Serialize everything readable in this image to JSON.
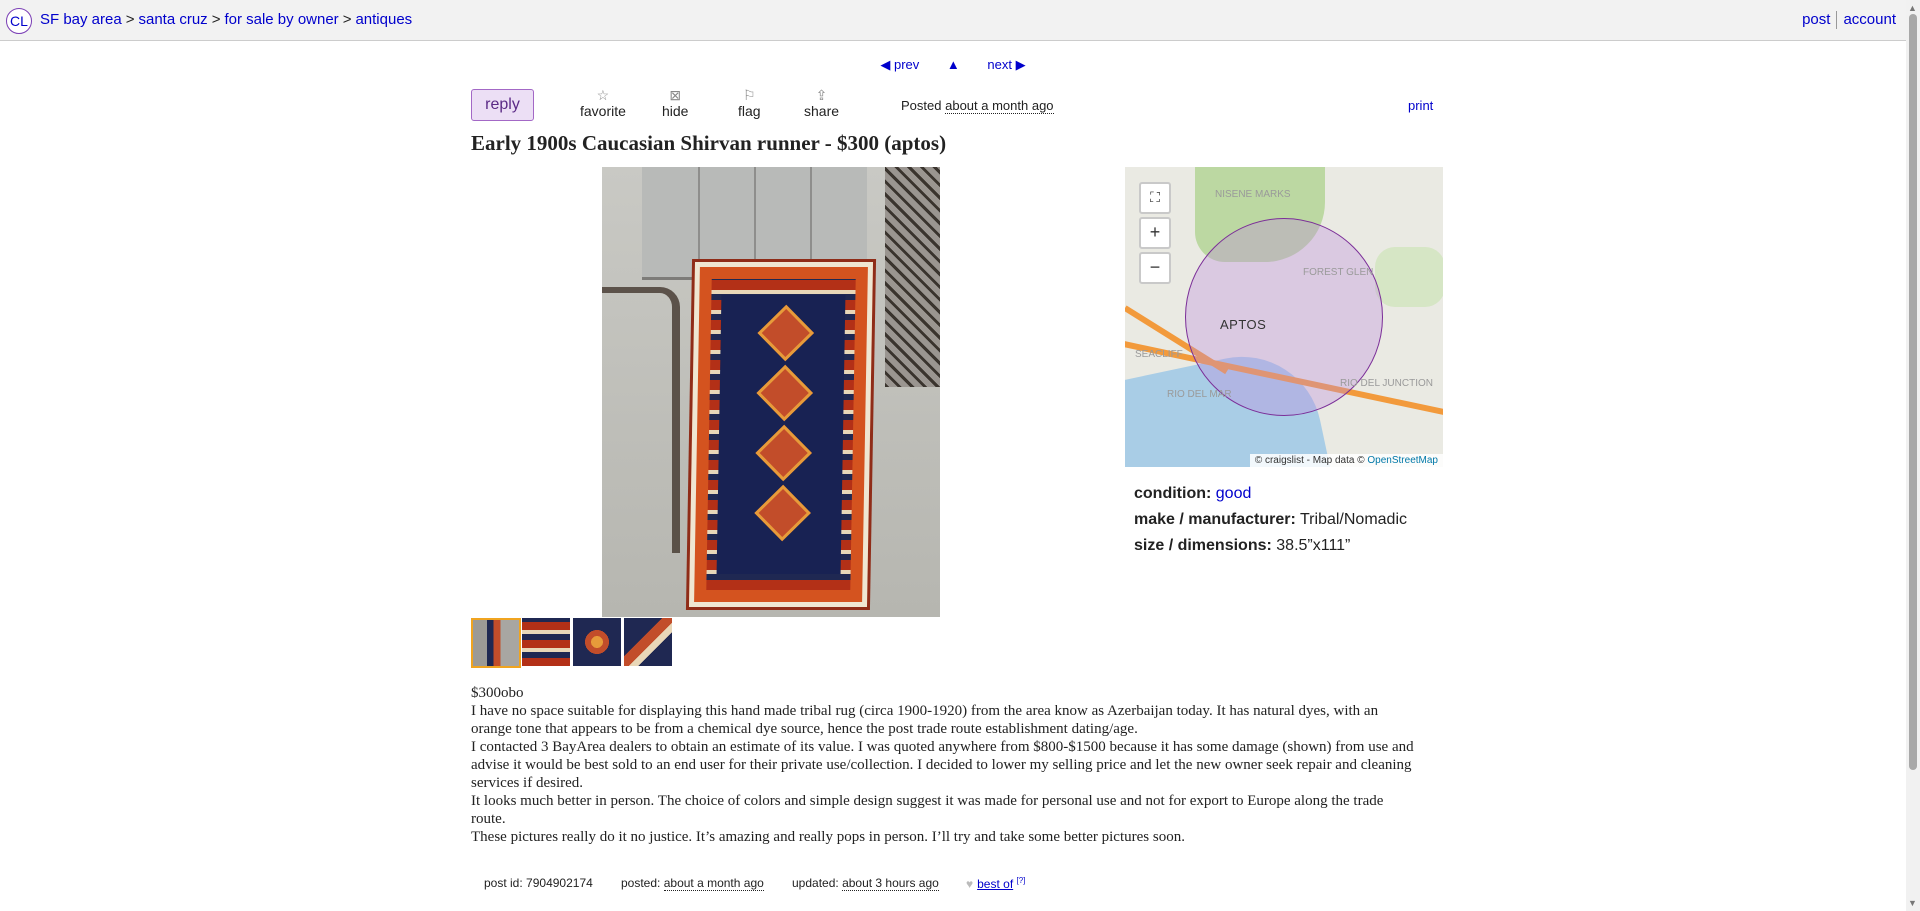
{
  "header": {
    "logo": "CL",
    "breadcrumbs": [
      "SF bay area",
      "santa cruz",
      "for sale by owner",
      "antiques"
    ],
    "separator": ">",
    "links": {
      "post": "post",
      "account": "account"
    }
  },
  "pager": {
    "prev": "◀ prev",
    "up": "▲",
    "next": "next ▶"
  },
  "actions": {
    "reply": "reply",
    "favorite": "favorite",
    "hide": "hide",
    "flag": "flag",
    "share": "share",
    "posted_label": "Posted",
    "posted_time": "about a month ago",
    "print": "print"
  },
  "posting": {
    "title": "Early 1900s Caucasian Shirvan runner - $300 (aptos)",
    "image_count": 4,
    "selected_thumb": 1
  },
  "map": {
    "place_label": "APTOS",
    "labels": [
      "FOREST GLEN",
      "SEACLIFF",
      "RIO DEL MAR",
      "RIO DEL JUNCTION",
      "NISENE MARKS"
    ],
    "controls": {
      "fullscreen": "⛶",
      "zoom_in": "+",
      "zoom_out": "−"
    },
    "attribution": "© craigslist - Map data ©",
    "attribution_link": "OpenStreetMap"
  },
  "attributes": [
    {
      "label": "condition:",
      "value": "good",
      "link": true
    },
    {
      "label": "make / manufacturer:",
      "value": "Tribal/Nomadic",
      "link": false
    },
    {
      "label": "size / dimensions:",
      "value": "38.5”x111”",
      "link": false
    }
  ],
  "body": [
    "$300obo",
    "I have no space suitable for displaying this hand made tribal rug (circa 1900-1920) from the area know as Azerbaijan today. It has natural dyes, with an orange tone that appears to be from a chemical dye source, hence the post trade route establishment dating/age.",
    "I contacted 3 BayArea dealers to obtain an estimate of its value. I was quoted anywhere from $800-$1500 because it has some damage (shown) from use and advise it would be best sold to an end user for their private use/collection. I decided to lower my selling price and let the new owner seek repair and cleaning services if desired.",
    "It looks much better in person. The choice of colors and simple design suggest it was made for personal use and not for export to Europe along the trade route.",
    "These pictures really do it no justice. It’s amazing and really pops in person. I’ll try and take some better pictures soon."
  ],
  "footer": {
    "post_id_label": "post id:",
    "post_id": "7904902174",
    "posted_label": "posted:",
    "posted_time": "about a month ago",
    "updated_label": "updated:",
    "updated_time": "about 3 hours ago",
    "best_of": "best of",
    "best_of_help": "[?]"
  },
  "colors": {
    "link": "#0000cc",
    "reply_bg": "#ecdff5",
    "reply_border": "#a368c6",
    "thumb_selected": "#f0a420",
    "map_circle": "#7b2e98"
  }
}
